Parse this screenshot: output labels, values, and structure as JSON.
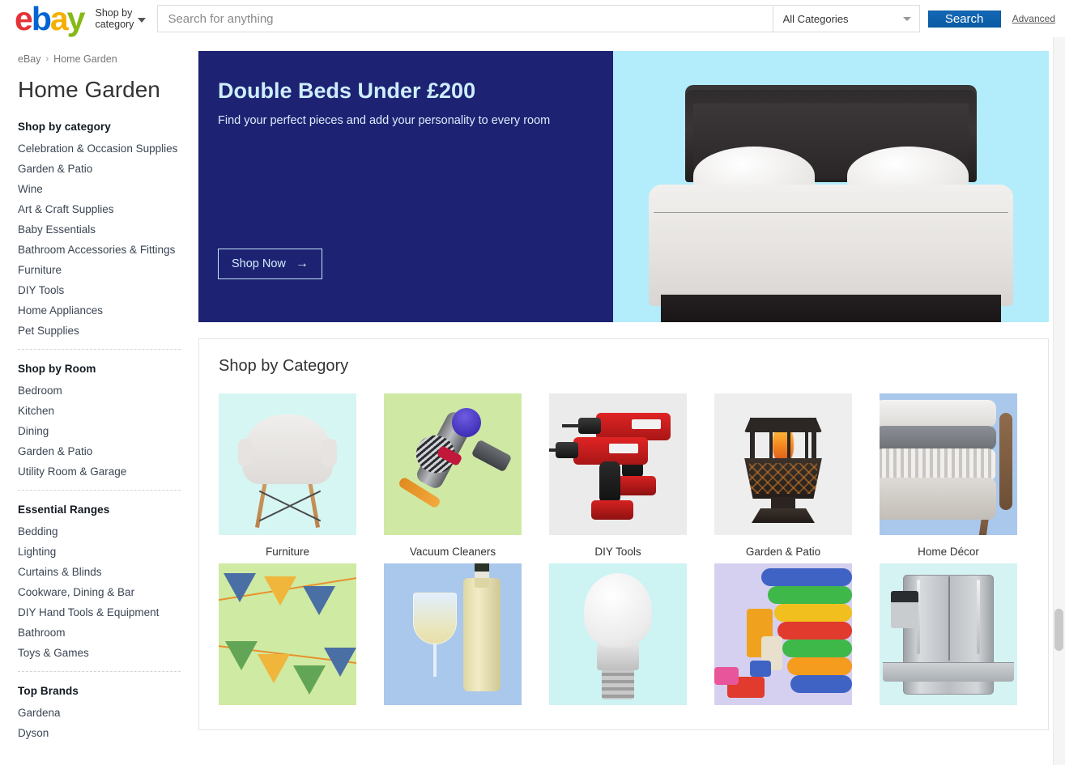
{
  "header": {
    "logo_letters": [
      "e",
      "b",
      "a",
      "y"
    ],
    "shop_by_category": "Shop by\ncategory",
    "search_placeholder": "Search for anything",
    "search_value": "",
    "category_selected": "All Categories",
    "search_button": "Search",
    "advanced_link": "Advanced"
  },
  "breadcrumb": {
    "root": "eBay",
    "separator": "›",
    "current": "Home Garden"
  },
  "page_title": "Home Garden",
  "sidebar": {
    "groups": [
      {
        "heading": "Shop by category",
        "items": [
          "Celebration & Occasion Supplies",
          "Garden & Patio",
          "Wine",
          "Art & Craft Supplies",
          "Baby Essentials",
          "Bathroom Accessories & Fittings",
          "Furniture",
          "DIY Tools",
          "Home Appliances",
          "Pet Supplies"
        ]
      },
      {
        "heading": "Shop by Room",
        "items": [
          "Bedroom",
          "Kitchen",
          "Dining",
          "Garden & Patio",
          "Utility Room & Garage"
        ]
      },
      {
        "heading": "Essential Ranges",
        "items": [
          "Bedding",
          "Lighting",
          "Curtains & Blinds",
          "Cookware, Dining & Bar",
          "DIY Hand Tools & Equipment",
          "Bathroom",
          "Toys & Games"
        ]
      },
      {
        "heading": "Top Brands",
        "items": [
          "Gardena",
          "Dyson"
        ]
      }
    ]
  },
  "hero": {
    "title": "Double Beds Under £200",
    "subtitle": "Find your perfect pieces and add your personality to every room",
    "cta_label": "Shop Now",
    "cta_arrow": "→",
    "background_color": "#1e2273",
    "image_background_color": "#b3ecfb",
    "image_alt": "double-bed-with-dark-headboard"
  },
  "shop_by_category": {
    "title": "Shop by Category",
    "tiles_row1": [
      {
        "label": "Furniture",
        "art": "a-furniture"
      },
      {
        "label": "Vacuum Cleaners",
        "art": "a-vacuum"
      },
      {
        "label": "DIY Tools",
        "art": "a-tools"
      },
      {
        "label": "Garden & Patio",
        "art": "a-garden"
      },
      {
        "label": "Home Décor",
        "art": "a-decor"
      }
    ],
    "tiles_row2": [
      {
        "label": "",
        "art": "a-party"
      },
      {
        "label": "",
        "art": "a-wine"
      },
      {
        "label": "",
        "art": "a-light"
      },
      {
        "label": "",
        "art": "a-toys"
      },
      {
        "label": "",
        "art": "a-fridge"
      }
    ]
  },
  "colors": {
    "ebay_red": "#e53238",
    "ebay_blue": "#0064d2",
    "ebay_yellow": "#f5af02",
    "ebay_green": "#86b817",
    "search_button_blue": "#0a5aa3",
    "hero_navy": "#1e2273"
  }
}
